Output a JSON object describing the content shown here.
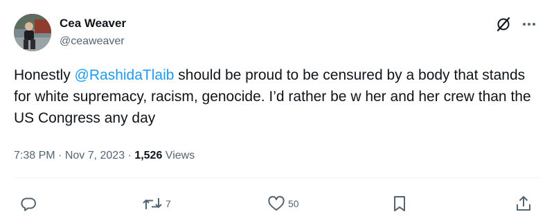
{
  "author": {
    "display_name": "Cea Weaver",
    "handle": "@ceaweaver"
  },
  "tweet": {
    "text_before": "Honestly ",
    "mention": "@RashidaTlaib",
    "text_after": " should be proud to be censured by a body that stands for white supremacy, racism, genocide. I’d rather be w her and her crew than the US Congress any day"
  },
  "meta": {
    "time": "7:38 PM",
    "date": "Nov 7, 2023",
    "separator": " · ",
    "views_count": "1,526",
    "views_label": " Views"
  },
  "actions": {
    "reply_count": "",
    "retweet_count": "7",
    "like_count": "50"
  },
  "colors": {
    "mention": "#1d9bf0",
    "text": "#0f1419",
    "secondary": "#536471"
  },
  "icons": [
    "avatar",
    "grok-icon",
    "more-icon",
    "reply-icon",
    "retweet-icon",
    "like-icon",
    "bookmark-icon",
    "share-icon"
  ]
}
